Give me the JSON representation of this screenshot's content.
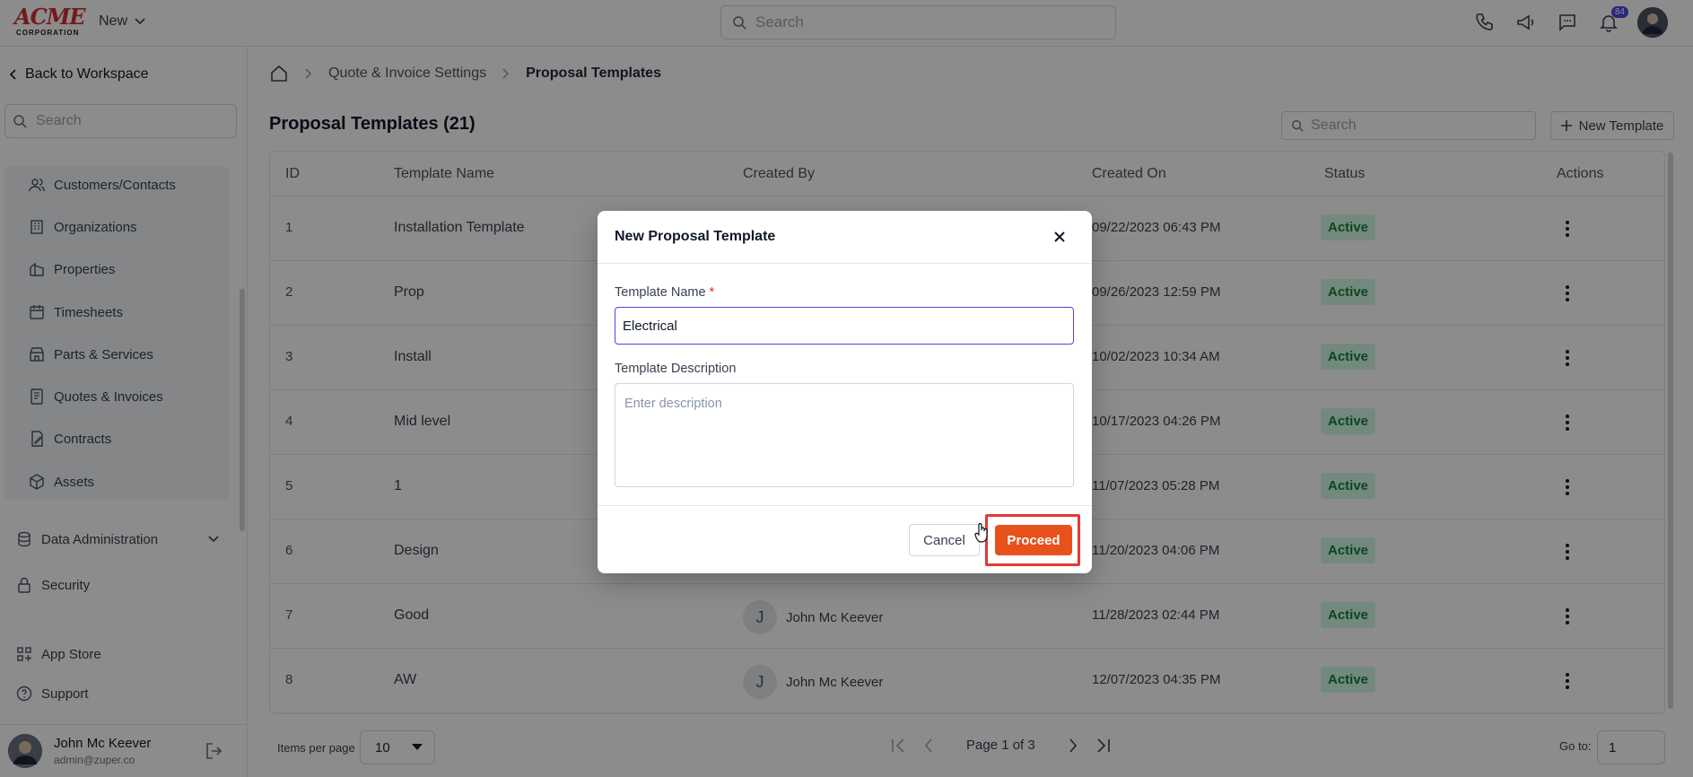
{
  "topbar": {
    "logo_main": "ACME",
    "logo_sub": "CORPORATION",
    "new_label": "New",
    "search_placeholder": "Search",
    "notification_count": "84"
  },
  "sidebar": {
    "back_label": "Back to Workspace",
    "search_placeholder": "Search",
    "items": [
      {
        "label": "Customers/Contacts",
        "icon": "users-icon"
      },
      {
        "label": "Organizations",
        "icon": "building-icon"
      },
      {
        "label": "Properties",
        "icon": "property-icon"
      },
      {
        "label": "Timesheets",
        "icon": "calendar-icon"
      },
      {
        "label": "Parts & Services",
        "icon": "store-icon"
      },
      {
        "label": "Quotes & Invoices",
        "icon": "invoice-icon"
      },
      {
        "label": "Contracts",
        "icon": "contract-icon"
      },
      {
        "label": "Assets",
        "icon": "cube-icon"
      }
    ],
    "data_admin_label": "Data Administration",
    "security_label": "Security",
    "app_store_label": "App Store",
    "support_label": "Support",
    "user_name": "John Mc Keever",
    "user_email": "admin@zuper.co"
  },
  "breadcrumb": {
    "parent": "Quote & Invoice Settings",
    "current": "Proposal Templates"
  },
  "page": {
    "title": "Proposal Templates (21)",
    "search_placeholder": "Search",
    "new_template_label": "New Template"
  },
  "table": {
    "headers": [
      "ID",
      "Template Name",
      "Created By",
      "Created On",
      "Status",
      "Actions"
    ],
    "rows": [
      {
        "id": "1",
        "name": "Installation Template",
        "created_by": "",
        "created_on": "09/22/2023 06:43 PM",
        "status": "Active"
      },
      {
        "id": "2",
        "name": "Prop",
        "created_by": "",
        "created_on": "09/26/2023 12:59 PM",
        "status": "Active"
      },
      {
        "id": "3",
        "name": "Install",
        "created_by": "",
        "created_on": "10/02/2023 10:34 AM",
        "status": "Active"
      },
      {
        "id": "4",
        "name": "Mid level",
        "created_by": "",
        "created_on": "10/17/2023 04:26 PM",
        "status": "Active"
      },
      {
        "id": "5",
        "name": "1",
        "created_by": "",
        "created_on": "11/07/2023 05:28 PM",
        "status": "Active"
      },
      {
        "id": "6",
        "name": "Design",
        "created_by": "",
        "created_on": "11/20/2023 04:06 PM",
        "status": "Active"
      },
      {
        "id": "7",
        "name": "Good",
        "created_by": "John Mc Keever",
        "created_on": "11/28/2023 02:44 PM",
        "status": "Active"
      },
      {
        "id": "8",
        "name": "AW",
        "created_by": "John Mc Keever",
        "created_on": "12/07/2023 04:35 PM",
        "status": "Active"
      }
    ],
    "creator_initial": "J"
  },
  "pager": {
    "items_per_page_label": "Items per page",
    "items_per_page": "10",
    "page_label": "Page 1 of 3",
    "goto_label": "Go to:",
    "goto_value": "1"
  },
  "modal": {
    "title": "New Proposal Template",
    "name_label": "Template Name",
    "required_mark": "*",
    "name_value": "Electrical",
    "description_label": "Template Description",
    "description_placeholder": "Enter description",
    "cancel_label": "Cancel",
    "proceed_label": "Proceed"
  },
  "colors": {
    "accent": "#e8501c",
    "highlight": "#e53935",
    "focus": "#4f46e5",
    "status_bg": "#d1fae5",
    "status_text": "#15803d"
  }
}
